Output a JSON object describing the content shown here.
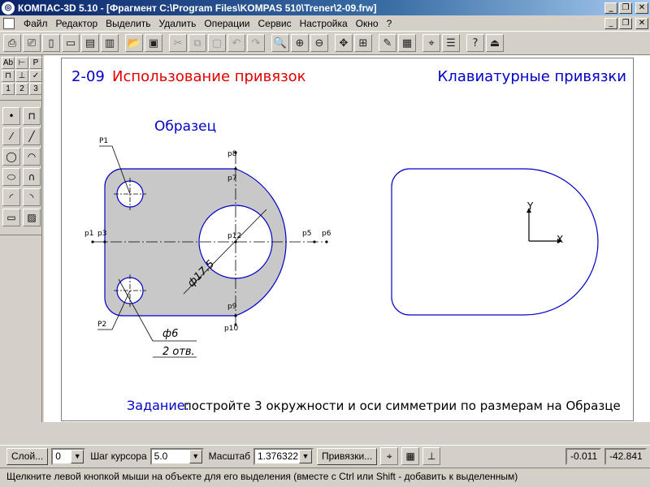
{
  "window": {
    "title": "КОМПАС-3D 5.10 - [Фрагмент C:\\Program Files\\KOMPAS 510\\Trener\\2-09.frw]",
    "logo_glyph": "◎",
    "min_glyph": "_",
    "restore_glyph": "❐",
    "close_glyph": "✕"
  },
  "menu": {
    "items": [
      "Файл",
      "Редактор",
      "Выделить",
      "Удалить",
      "Операции",
      "Сервис",
      "Настройка",
      "Окно",
      "?"
    ]
  },
  "toolbar": {
    "buttons": [
      {
        "icon": "print-preview-icon",
        "glyph": "⎙"
      },
      {
        "icon": "print-icon",
        "glyph": "⎚"
      },
      {
        "icon": "new-file-icon",
        "glyph": "▯"
      },
      {
        "icon": "new-fragment-icon",
        "glyph": "▭"
      },
      {
        "icon": "new-document-icon",
        "glyph": "▤"
      },
      {
        "icon": "new-spec-icon",
        "glyph": "▥"
      },
      {
        "icon": "open-folder-icon",
        "glyph": "📂"
      },
      {
        "icon": "save-icon",
        "glyph": "▣"
      },
      {
        "icon": "cut-icon",
        "glyph": "✂"
      },
      {
        "icon": "copy-icon",
        "glyph": "⧉"
      },
      {
        "icon": "paste-icon",
        "glyph": "▢"
      },
      {
        "icon": "undo-icon",
        "glyph": "↶"
      },
      {
        "icon": "redo-icon",
        "glyph": "↷"
      },
      {
        "icon": "zoom-icon",
        "glyph": "🔍"
      },
      {
        "icon": "zoom-in-icon",
        "glyph": "⊕"
      },
      {
        "icon": "zoom-out-icon",
        "glyph": "⊖"
      },
      {
        "icon": "pan-icon",
        "glyph": "✥"
      },
      {
        "icon": "zoom-all-icon",
        "glyph": "⊞"
      },
      {
        "icon": "regenerate-icon",
        "glyph": "✎"
      },
      {
        "icon": "layers-icon",
        "glyph": "▦"
      },
      {
        "icon": "measure-icon",
        "glyph": "⌖"
      },
      {
        "icon": "library-icon",
        "glyph": "☰"
      },
      {
        "icon": "help-icon",
        "glyph": "?"
      },
      {
        "icon": "exit-icon",
        "glyph": "⏏"
      }
    ]
  },
  "left_panel": {
    "tabs": [
      "Ab",
      "⊢",
      "P",
      "⊓",
      "⊥",
      "✓",
      "1",
      "2",
      "3"
    ],
    "tools": [
      {
        "icon": "point-icon",
        "glyph": "•"
      },
      {
        "icon": "polyline-icon",
        "glyph": "⊓"
      },
      {
        "icon": "segment-icon",
        "glyph": "⁄"
      },
      {
        "icon": "aux-line-icon",
        "glyph": "╱"
      },
      {
        "icon": "circle-icon",
        "glyph": "◯"
      },
      {
        "icon": "arc-icon",
        "glyph": "◠"
      },
      {
        "icon": "ellipse-icon",
        "glyph": "⬭"
      },
      {
        "icon": "bezier-icon",
        "glyph": "∩"
      },
      {
        "icon": "fillet-icon",
        "glyph": "◜"
      },
      {
        "icon": "chamfer-icon",
        "glyph": "◝"
      },
      {
        "icon": "rectangle-icon",
        "glyph": "▭"
      },
      {
        "icon": "hatch-icon",
        "glyph": "▨"
      }
    ]
  },
  "drawing": {
    "lesson_number": "2-09",
    "lesson_title": "Использование привязок",
    "mode_title": "Клавиатурные привязки",
    "sample_label": "Образец",
    "task_label": "Задание:",
    "task_text": "постройте 3 окружности и оси симметрии по размерам на Образце",
    "points": [
      "p1",
      "p2",
      "p3",
      "p4",
      "p5",
      "p6",
      "p7",
      "p8",
      "p9",
      "p10",
      "p12"
    ],
    "callouts": [
      "P1",
      "P2"
    ],
    "dim_big": "ф17.5",
    "dim_small": "ф6",
    "dim_small_count": "2 отв.",
    "axis_x": "X",
    "axis_y": "Y",
    "colors": {
      "outline": "#0000c8",
      "fill": "#c8c8c8",
      "red": "#e00000"
    }
  },
  "statusbar": {
    "layer_btn": "Слой...",
    "layer_value": "0",
    "step_label": "Шаг курсора",
    "step_value": "5.0",
    "scale_label": "Масштаб",
    "scale_value": "1.376322",
    "snaps_btn": "Привязки...",
    "icons": [
      {
        "icon": "snap-toggle-icon",
        "glyph": "⌖"
      },
      {
        "icon": "grid-icon",
        "glyph": "▦"
      },
      {
        "icon": "ortho-icon",
        "glyph": "⊥"
      }
    ],
    "coord_x": "-0.011",
    "coord_y": "-42.841",
    "dropdown_glyph": "▼"
  },
  "hint": "Щелкните левой кнопкой мыши на объекте для его выделения (вместе с Ctrl или Shift - добавить к выделенным)"
}
